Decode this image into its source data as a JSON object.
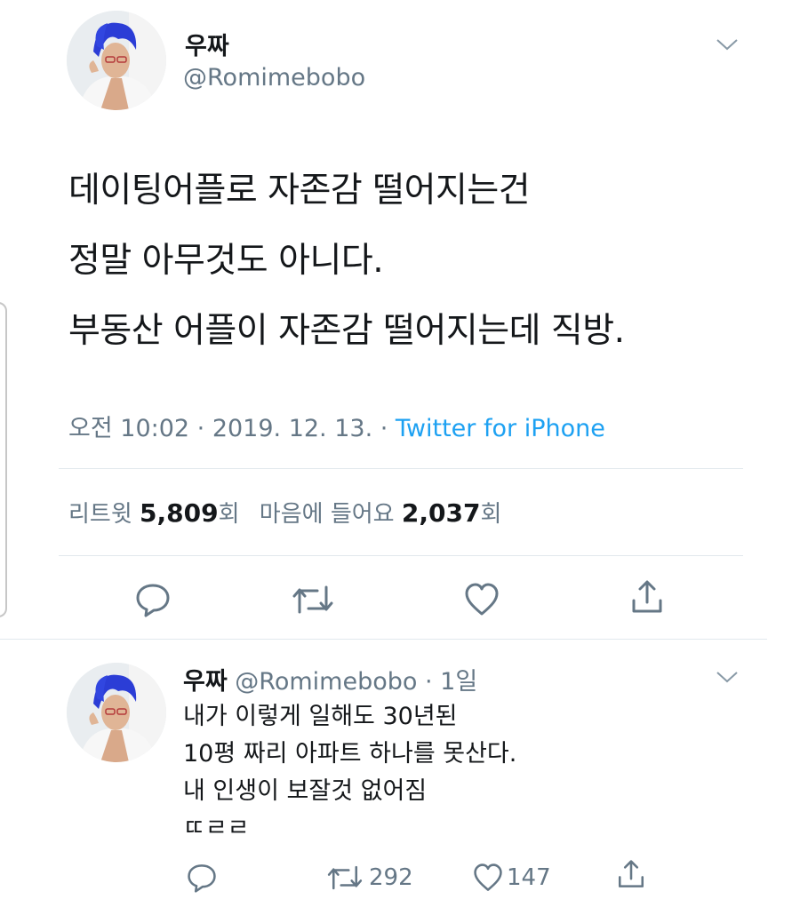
{
  "tweet": {
    "author_name": "우짜",
    "author_handle": "@Romimebobo",
    "text_lines": [
      "데이팅어플로 자존감 떨어지는건",
      "정말 아무것도 아니다.",
      "부동산 어플이 자존감 떨어지는데 직방."
    ],
    "timestamp": "오전 10:02 · 2019. 12. 13. · ",
    "source": "Twitter for iPhone",
    "retweet_label": "리트윗",
    "retweet_count": "5,809",
    "retweet_unit": "회",
    "like_label": "마음에 들어요",
    "like_count": "2,037",
    "like_unit": "회"
  },
  "reply": {
    "author_name": "우짜",
    "author_handle": "@Romimebobo",
    "time": "· 1일",
    "text_lines": [
      "내가 이렇게 일해도 30년된",
      "10평 짜리 아파트 하나를 못산다.",
      "내 인생이 보잘것 없어짐",
      "ㄸㄹㄹ"
    ],
    "retweet_count": "292",
    "like_count": "147"
  },
  "icons": {
    "caret": "chevron-down-icon",
    "reply": "reply-icon",
    "retweet": "retweet-icon",
    "like": "heart-icon",
    "share": "share-icon"
  },
  "colors": {
    "text": "#14171a",
    "secondary": "#657786",
    "link": "#1da1f2",
    "divider": "#e1e8ed"
  }
}
